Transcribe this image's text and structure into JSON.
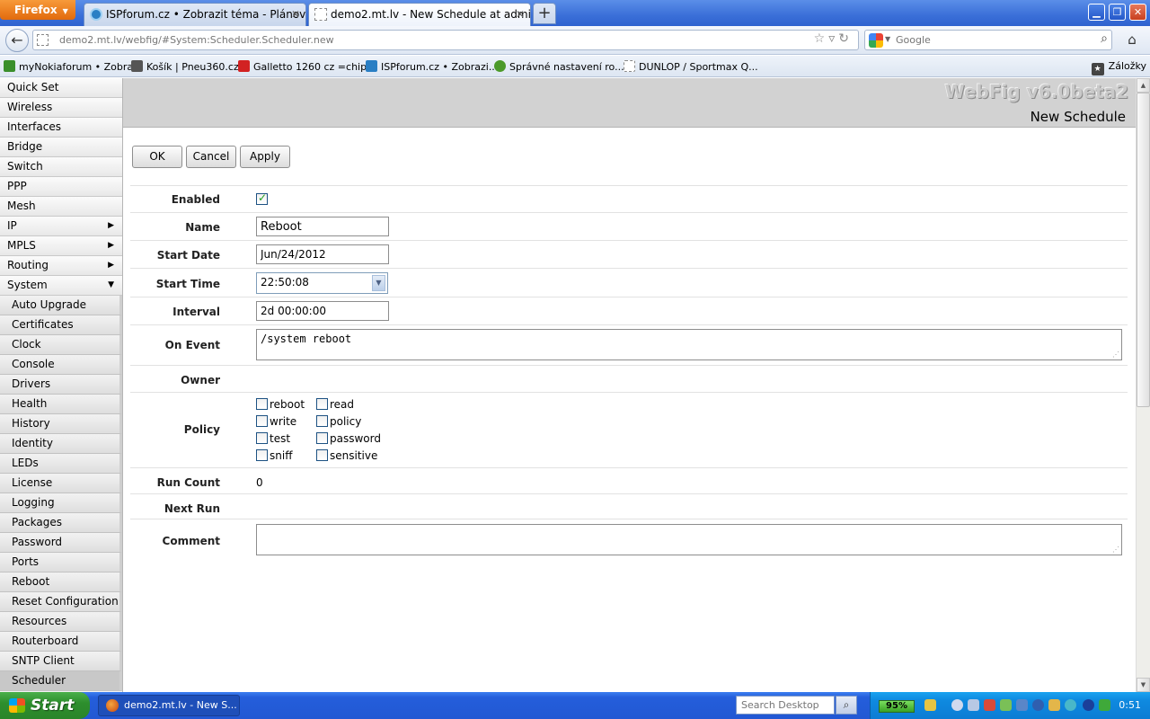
{
  "browser": {
    "menu_button": "Firefox",
    "tabs": [
      {
        "title": "ISPforum.cz • Zobrazit téma - Plánovaný ...",
        "active": false
      },
      {
        "title": "demo2.mt.lv - New Schedule at admin@d...",
        "active": true
      }
    ],
    "url": "demo2.mt.lv/webfig/#System:Scheduler.Scheduler.new",
    "search_placeholder": "Google",
    "bookmarks": [
      {
        "label": "myNokiaforum • Zobra...",
        "icon_color": "#3a8f2c"
      },
      {
        "label": "Košík | Pneu360.cz",
        "icon_color": "#555555"
      },
      {
        "label": "Galletto 1260 cz =chip...",
        "icon_color": "#d22222"
      },
      {
        "label": "ISPforum.cz • Zobrazi...",
        "icon_color": "#2a7fc4"
      },
      {
        "label": "Správné nastavení ro...",
        "icon_color": "#4c9a2a"
      },
      {
        "label": "DUNLOP / Sportmax Q...",
        "icon_color": "#ffffff"
      }
    ],
    "bookmarks_menu": "Záložky"
  },
  "sidebar": {
    "items": [
      {
        "label": "Quick Set",
        "arrow": ""
      },
      {
        "label": "Wireless",
        "arrow": ""
      },
      {
        "label": "Interfaces",
        "arrow": ""
      },
      {
        "label": "Bridge",
        "arrow": ""
      },
      {
        "label": "Switch",
        "arrow": ""
      },
      {
        "label": "PPP",
        "arrow": ""
      },
      {
        "label": "Mesh",
        "arrow": ""
      },
      {
        "label": "IP",
        "arrow": "▶"
      },
      {
        "label": "MPLS",
        "arrow": "▶"
      },
      {
        "label": "Routing",
        "arrow": "▶"
      },
      {
        "label": "System",
        "arrow": "▼"
      }
    ],
    "sub_items": [
      "Auto Upgrade",
      "Certificates",
      "Clock",
      "Console",
      "Drivers",
      "Health",
      "History",
      "Identity",
      "LEDs",
      "License",
      "Logging",
      "Packages",
      "Password",
      "Ports",
      "Reboot",
      "Reset Configuration",
      "Resources",
      "Routerboard",
      "SNTP Client",
      "Scheduler"
    ],
    "selected_sub_item": "Scheduler"
  },
  "header": {
    "product": "WebFig v6.0beta2",
    "page_title": "New Schedule"
  },
  "buttons": {
    "ok": "OK",
    "cancel": "Cancel",
    "apply": "Apply"
  },
  "form": {
    "enabled_label": "Enabled",
    "enabled": true,
    "name_label": "Name",
    "name_value": "Reboot",
    "start_date_label": "Start Date",
    "start_date_value": "Jun/24/2012",
    "start_time_label": "Start Time",
    "start_time_value": "22:50:08",
    "interval_label": "Interval",
    "interval_value": "2d 00:00:00",
    "on_event_label": "On Event",
    "on_event_value": "/system reboot",
    "owner_label": "Owner",
    "owner_value": "",
    "policy_label": "Policy",
    "policies": [
      {
        "name": "reboot",
        "checked": false
      },
      {
        "name": "read",
        "checked": false
      },
      {
        "name": "write",
        "checked": false
      },
      {
        "name": "policy",
        "checked": false
      },
      {
        "name": "test",
        "checked": false
      },
      {
        "name": "password",
        "checked": false
      },
      {
        "name": "sniff",
        "checked": false
      },
      {
        "name": "sensitive",
        "checked": false
      }
    ],
    "run_count_label": "Run Count",
    "run_count_value": "0",
    "next_run_label": "Next Run",
    "next_run_value": "",
    "comment_label": "Comment",
    "comment_value": ""
  },
  "taskbar": {
    "start_label": "Start",
    "task_label": "demo2.mt.lv - New S...",
    "search_placeholder": "Search Desktop",
    "battery": "95%",
    "clock": "0:51"
  }
}
